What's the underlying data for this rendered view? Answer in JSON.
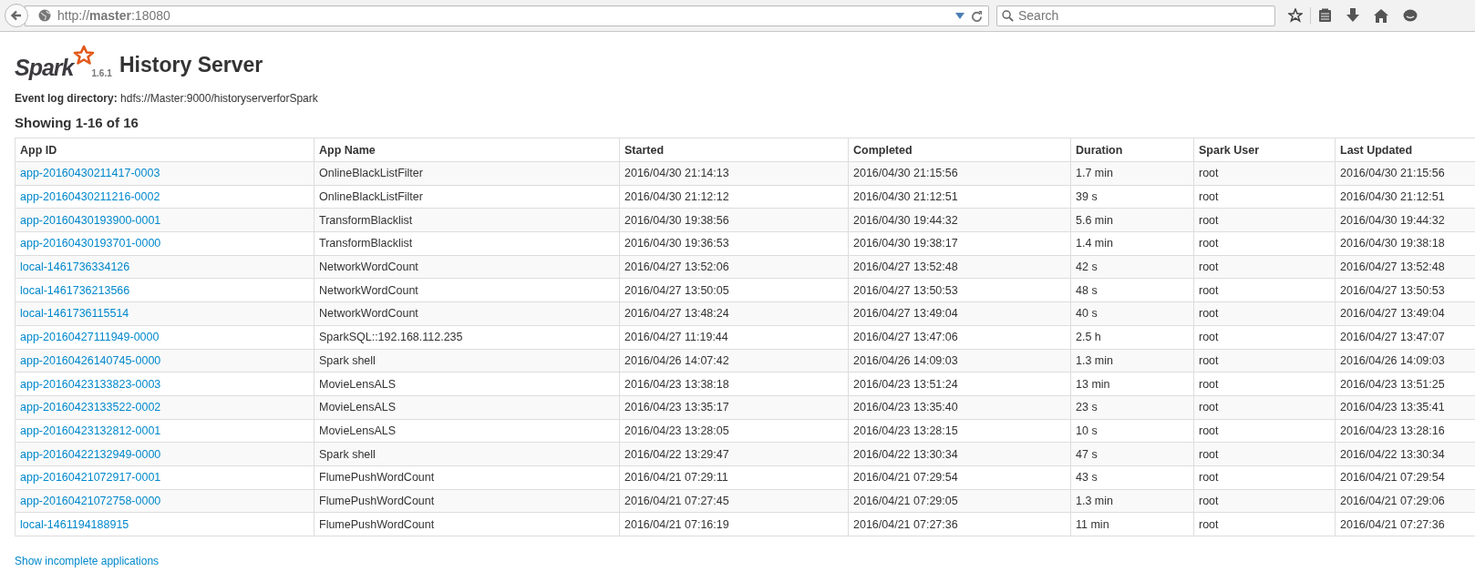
{
  "browser": {
    "url": "http://**master**:18080",
    "search_placeholder": "Search"
  },
  "logo": {
    "text": "Spark",
    "version": "1.6.1"
  },
  "title": "History Server",
  "event_log": {
    "label": "Event log directory:",
    "value": "hdfs://Master:9000/historyserverforSpark"
  },
  "showing": "Showing 1-16 of 16",
  "table": {
    "columns": [
      "App ID",
      "App Name",
      "Started",
      "Completed",
      "Duration",
      "Spark User",
      "Last Updated"
    ],
    "rows": [
      [
        "app-20160430211417-0003",
        "OnlineBlackListFilter",
        "2016/04/30 21:14:13",
        "2016/04/30 21:15:56",
        "1.7 min",
        "root",
        "2016/04/30 21:15:56"
      ],
      [
        "app-20160430211216-0002",
        "OnlineBlackListFilter",
        "2016/04/30 21:12:12",
        "2016/04/30 21:12:51",
        "39 s",
        "root",
        "2016/04/30 21:12:51"
      ],
      [
        "app-20160430193900-0001",
        "TransformBlacklist",
        "2016/04/30 19:38:56",
        "2016/04/30 19:44:32",
        "5.6 min",
        "root",
        "2016/04/30 19:44:32"
      ],
      [
        "app-20160430193701-0000",
        "TransformBlacklist",
        "2016/04/30 19:36:53",
        "2016/04/30 19:38:17",
        "1.4 min",
        "root",
        "2016/04/30 19:38:18"
      ],
      [
        "local-1461736334126",
        "NetworkWordCount",
        "2016/04/27 13:52:06",
        "2016/04/27 13:52:48",
        "42 s",
        "root",
        "2016/04/27 13:52:48"
      ],
      [
        "local-1461736213566",
        "NetworkWordCount",
        "2016/04/27 13:50:05",
        "2016/04/27 13:50:53",
        "48 s",
        "root",
        "2016/04/27 13:50:53"
      ],
      [
        "local-1461736115514",
        "NetworkWordCount",
        "2016/04/27 13:48:24",
        "2016/04/27 13:49:04",
        "40 s",
        "root",
        "2016/04/27 13:49:04"
      ],
      [
        "app-20160427111949-0000",
        "SparkSQL::192.168.112.235",
        "2016/04/27 11:19:44",
        "2016/04/27 13:47:06",
        "2.5 h",
        "root",
        "2016/04/27 13:47:07"
      ],
      [
        "app-20160426140745-0000",
        "Spark shell",
        "2016/04/26 14:07:42",
        "2016/04/26 14:09:03",
        "1.3 min",
        "root",
        "2016/04/26 14:09:03"
      ],
      [
        "app-20160423133823-0003",
        "MovieLensALS",
        "2016/04/23 13:38:18",
        "2016/04/23 13:51:24",
        "13 min",
        "root",
        "2016/04/23 13:51:25"
      ],
      [
        "app-20160423133522-0002",
        "MovieLensALS",
        "2016/04/23 13:35:17",
        "2016/04/23 13:35:40",
        "23 s",
        "root",
        "2016/04/23 13:35:41"
      ],
      [
        "app-20160423132812-0001",
        "MovieLensALS",
        "2016/04/23 13:28:05",
        "2016/04/23 13:28:15",
        "10 s",
        "root",
        "2016/04/23 13:28:16"
      ],
      [
        "app-20160422132949-0000",
        "Spark shell",
        "2016/04/22 13:29:47",
        "2016/04/22 13:30:34",
        "47 s",
        "root",
        "2016/04/22 13:30:34"
      ],
      [
        "app-20160421072917-0001",
        "FlumePushWordCount",
        "2016/04/21 07:29:11",
        "2016/04/21 07:29:54",
        "43 s",
        "root",
        "2016/04/21 07:29:54"
      ],
      [
        "app-20160421072758-0000",
        "FlumePushWordCount",
        "2016/04/21 07:27:45",
        "2016/04/21 07:29:05",
        "1.3 min",
        "root",
        "2016/04/21 07:29:06"
      ],
      [
        "local-1461194188915",
        "FlumePushWordCount",
        "2016/04/21 07:16:19",
        "2016/04/21 07:27:36",
        "11 min",
        "root",
        "2016/04/21 07:27:36"
      ]
    ]
  },
  "footer_link": "Show incomplete applications"
}
